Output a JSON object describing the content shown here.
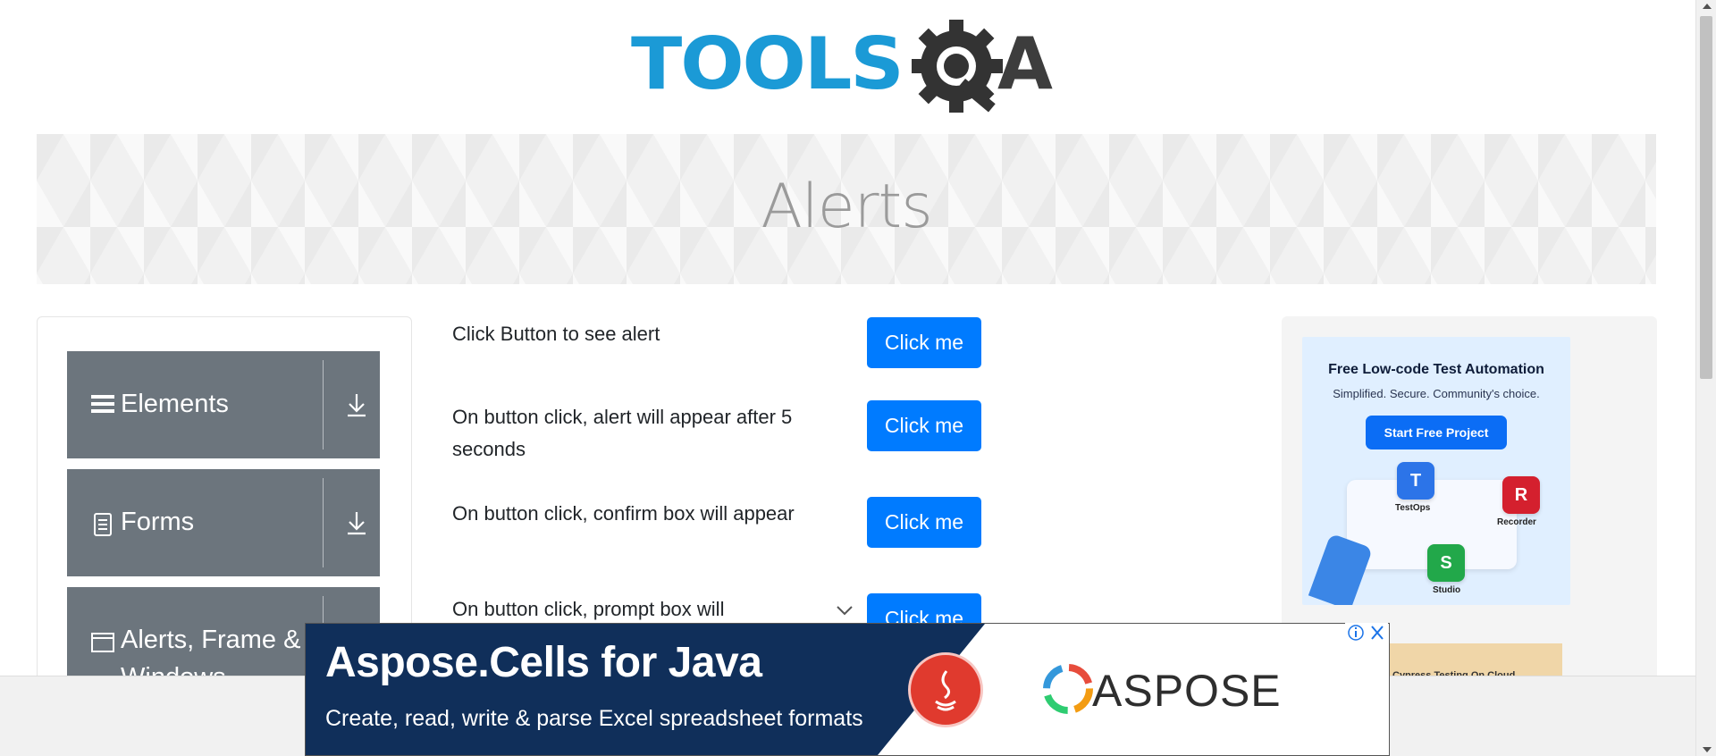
{
  "logo": {
    "left_text": "TOOLS",
    "right_text": "A"
  },
  "banner": {
    "title": "Alerts"
  },
  "sidebar": {
    "groups": [
      {
        "label": "Elements",
        "icon": "hamburger-icon"
      },
      {
        "label": "Forms",
        "icon": "document-icon"
      },
      {
        "label": "Alerts, Frame & Windows",
        "icon": "window-icon"
      }
    ]
  },
  "alerts": {
    "rows": [
      {
        "text": "Click Button to see alert",
        "button": "Click me"
      },
      {
        "text": "On button click, alert will appear after 5 seconds",
        "button": "Click me"
      },
      {
        "text": "On button click, confirm box will appear",
        "button": "Click me"
      },
      {
        "text": "On button click, prompt box will",
        "button": "Click me"
      }
    ]
  },
  "right_ad": {
    "headline": "Free Low-code Test Automation",
    "tagline": "Simplified. Secure. Community's choice.",
    "cta": "Start Free Project",
    "labels": [
      "TestOps",
      "Recorder",
      "Studio"
    ],
    "second_ad_text": "Cypress Testing On Cloud"
  },
  "bottom_ad": {
    "title": "Aspose.Cells for Java",
    "subtitle": "Create, read, write & parse Excel spreadsheet formats",
    "brand": "ASPOSE"
  },
  "colors": {
    "primary_button": "#007bff",
    "sidebar_group": "#6c757d",
    "logo_blue": "#1b9ad6",
    "ad_dark": "#102f5a"
  }
}
